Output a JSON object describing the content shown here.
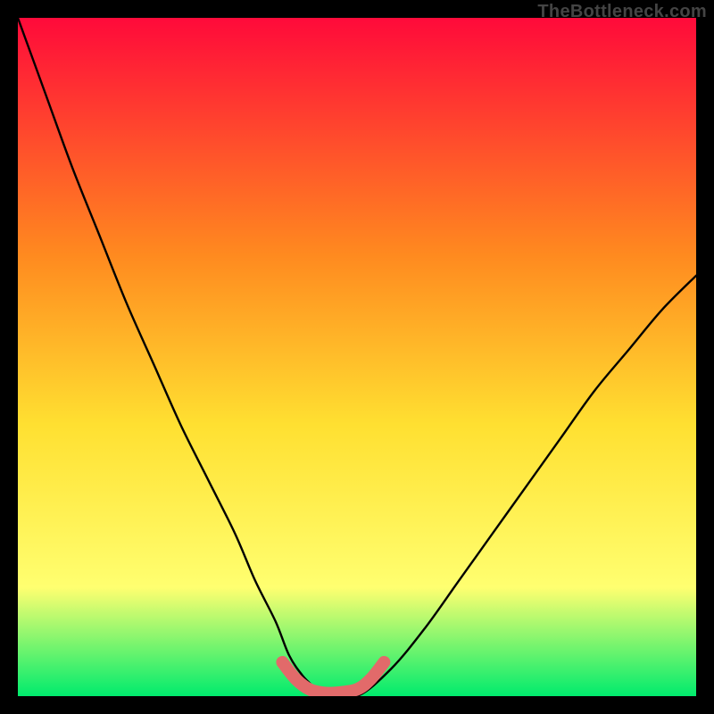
{
  "watermark": "TheBottleneck.com",
  "colors": {
    "gradient_top": "#ff0a3a",
    "gradient_mid1": "#ff8a1f",
    "gradient_mid2": "#ffe031",
    "gradient_mid3": "#ffff70",
    "gradient_bottom": "#00eb6d",
    "curve": "#000000",
    "marker": "#e26a6a",
    "frame": "#000000"
  },
  "chart_data": {
    "type": "line",
    "title": "",
    "xlabel": "",
    "ylabel": "",
    "xlim": [
      0,
      100
    ],
    "ylim": [
      0,
      100
    ],
    "series": [
      {
        "name": "bottleneck-curve",
        "x": [
          0,
          4,
          8,
          12,
          16,
          20,
          24,
          28,
          32,
          35,
          38,
          40,
          42,
          44,
          45,
          50,
          55,
          60,
          65,
          70,
          75,
          80,
          85,
          90,
          95,
          100
        ],
        "y": [
          100,
          89,
          78,
          68,
          58,
          49,
          40,
          32,
          24,
          17,
          11,
          6,
          3,
          1,
          0,
          0,
          4,
          10,
          17,
          24,
          31,
          38,
          45,
          51,
          57,
          62
        ]
      },
      {
        "name": "optimal-band",
        "x": [
          39,
          41,
          43,
          45,
          47,
          50,
          52,
          54
        ],
        "y": [
          5,
          2.5,
          1,
          0.5,
          0.5,
          1,
          2.5,
          5
        ]
      }
    ],
    "annotations": []
  }
}
